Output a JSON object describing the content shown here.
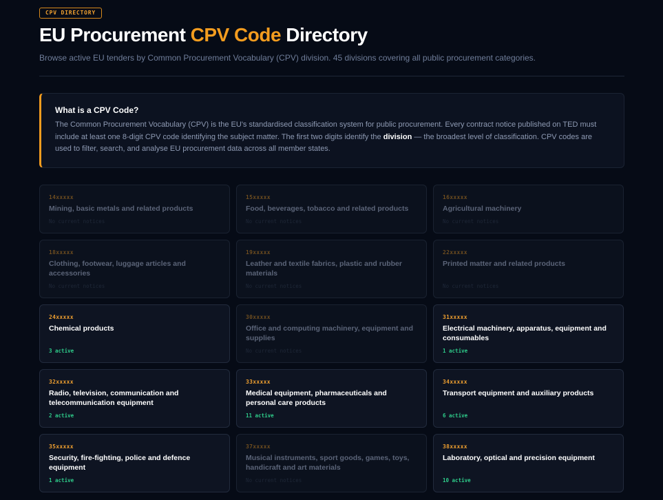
{
  "header": {
    "badge": "CPV DIRECTORY",
    "title_part1": "EU Procurement ",
    "title_accent": "CPV Code",
    "title_part2": " Directory",
    "subtitle": "Browse active EU tenders by Common Procurement Vocabulary (CPV) division. 45 divisions covering all public procurement categories."
  },
  "info": {
    "title": "What is a CPV Code?",
    "body_part1": "The Common Procurement Vocabulary (CPV) is the EU's standardised classification system for public procurement. Every contract notice published on TED must include at least one 8-digit CPV code identifying the subject matter. The first two digits identify the ",
    "body_bold": "division",
    "body_part2": " — the broadest level of classification. CPV codes are used to filter, search, and analyse EU procurement data across all member states."
  },
  "colors": {
    "accent": "#f39c1f",
    "active_green": "#2ecc8a",
    "background": "#060b16"
  },
  "divisions": [
    {
      "code": "14xxxxx",
      "name": "Mining, basic metals and related products",
      "status": "No current notices",
      "active": false
    },
    {
      "code": "15xxxxx",
      "name": "Food, beverages, tobacco and related products",
      "status": "No current notices",
      "active": false
    },
    {
      "code": "16xxxxx",
      "name": "Agricultural machinery",
      "status": "No current notices",
      "active": false
    },
    {
      "code": "18xxxxx",
      "name": "Clothing, footwear, luggage articles and accessories",
      "status": "No current notices",
      "active": false
    },
    {
      "code": "19xxxxx",
      "name": "Leather and textile fabrics, plastic and rubber materials",
      "status": "No current notices",
      "active": false
    },
    {
      "code": "22xxxxx",
      "name": "Printed matter and related products",
      "status": "No current notices",
      "active": false
    },
    {
      "code": "24xxxxx",
      "name": "Chemical products",
      "status": "3 active",
      "active": true
    },
    {
      "code": "30xxxxx",
      "name": "Office and computing machinery, equipment and supplies",
      "status": "No current notices",
      "active": false
    },
    {
      "code": "31xxxxx",
      "name": "Electrical machinery, apparatus, equipment and consumables",
      "status": "1 active",
      "active": true
    },
    {
      "code": "32xxxxx",
      "name": "Radio, television, communication and telecommunication equipment",
      "status": "2 active",
      "active": true
    },
    {
      "code": "33xxxxx",
      "name": "Medical equipment, pharmaceuticals and personal care products",
      "status": "11 active",
      "active": true
    },
    {
      "code": "34xxxxx",
      "name": "Transport equipment and auxiliary products",
      "status": "6 active",
      "active": true
    },
    {
      "code": "35xxxxx",
      "name": "Security, fire-fighting, police and defence equipment",
      "status": "1 active",
      "active": true
    },
    {
      "code": "37xxxxx",
      "name": "Musical instruments, sport goods, games, toys, handicraft and art materials",
      "status": "No current notices",
      "active": false
    },
    {
      "code": "38xxxxx",
      "name": "Laboratory, optical and precision equipment",
      "status": "10 active",
      "active": true
    }
  ]
}
